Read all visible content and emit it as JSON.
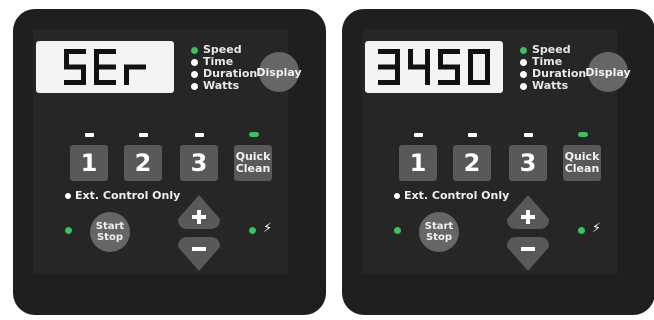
{
  "panels": [
    {
      "display_value": "5Er",
      "legend": [
        {
          "label": "Speed",
          "active": true
        },
        {
          "label": "Time",
          "active": false
        },
        {
          "label": "Duration",
          "active": false
        },
        {
          "label": "Watts",
          "active": false
        }
      ],
      "display_button": "Display",
      "presets": [
        "1",
        "2",
        "3"
      ],
      "quick_clean": {
        "line1": "Quick",
        "line2": "Clean"
      },
      "ext_control": "Ext. Control Only",
      "start_stop": {
        "line1": "Start",
        "line2": "Stop"
      },
      "power_symbol": "⚡"
    },
    {
      "display_value": "3450",
      "legend": [
        {
          "label": "Speed",
          "active": true
        },
        {
          "label": "Time",
          "active": false
        },
        {
          "label": "Duration",
          "active": false
        },
        {
          "label": "Watts",
          "active": false
        }
      ],
      "display_button": "Display",
      "presets": [
        "1",
        "2",
        "3"
      ],
      "quick_clean": {
        "line1": "Quick",
        "line2": "Clean"
      },
      "ext_control": "Ext. Control Only",
      "start_stop": {
        "line1": "Start",
        "line2": "Stop"
      },
      "power_symbol": "⚡"
    }
  ],
  "colors": {
    "panel": "#1f1f1f",
    "face": "#262626",
    "button": "#595959",
    "round_button": "#666666",
    "led_green": "#35c35a",
    "lcd_background": "#f4f4f4",
    "lcd_segment": "#111111"
  }
}
